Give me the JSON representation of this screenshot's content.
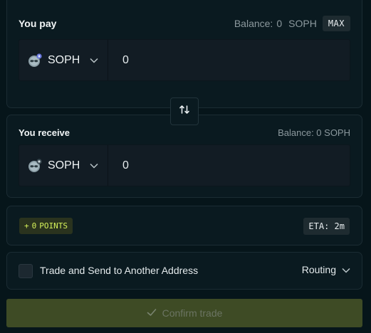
{
  "pay": {
    "label": "You pay",
    "balance_label": "Balance:",
    "balance_value": "0",
    "balance_token": "SOPH",
    "max_label": "MAX",
    "token": "SOPH",
    "token_icon": "soph-token-icon",
    "amount": "0"
  },
  "receive": {
    "label": "You receive",
    "balance_text": "Balance: 0 SOPH",
    "token": "SOPH",
    "token_icon": "soph-token-icon",
    "amount": "0"
  },
  "swap_icon": "swap-arrows-icon",
  "points": {
    "plus": "+",
    "value": "0",
    "label": "POINTS"
  },
  "eta": {
    "text": "ETA: 2m"
  },
  "address": {
    "checkbox_checked": false,
    "label": "Trade and Send to Another Address"
  },
  "routing": {
    "label": "Routing"
  },
  "confirm": {
    "label": "Confirm trade",
    "icon": "check-icon"
  },
  "colors": {
    "background": "#06151a",
    "card": "#0a1a20",
    "points_text": "#d6f25a",
    "confirm_bg": "#3e4b25"
  }
}
